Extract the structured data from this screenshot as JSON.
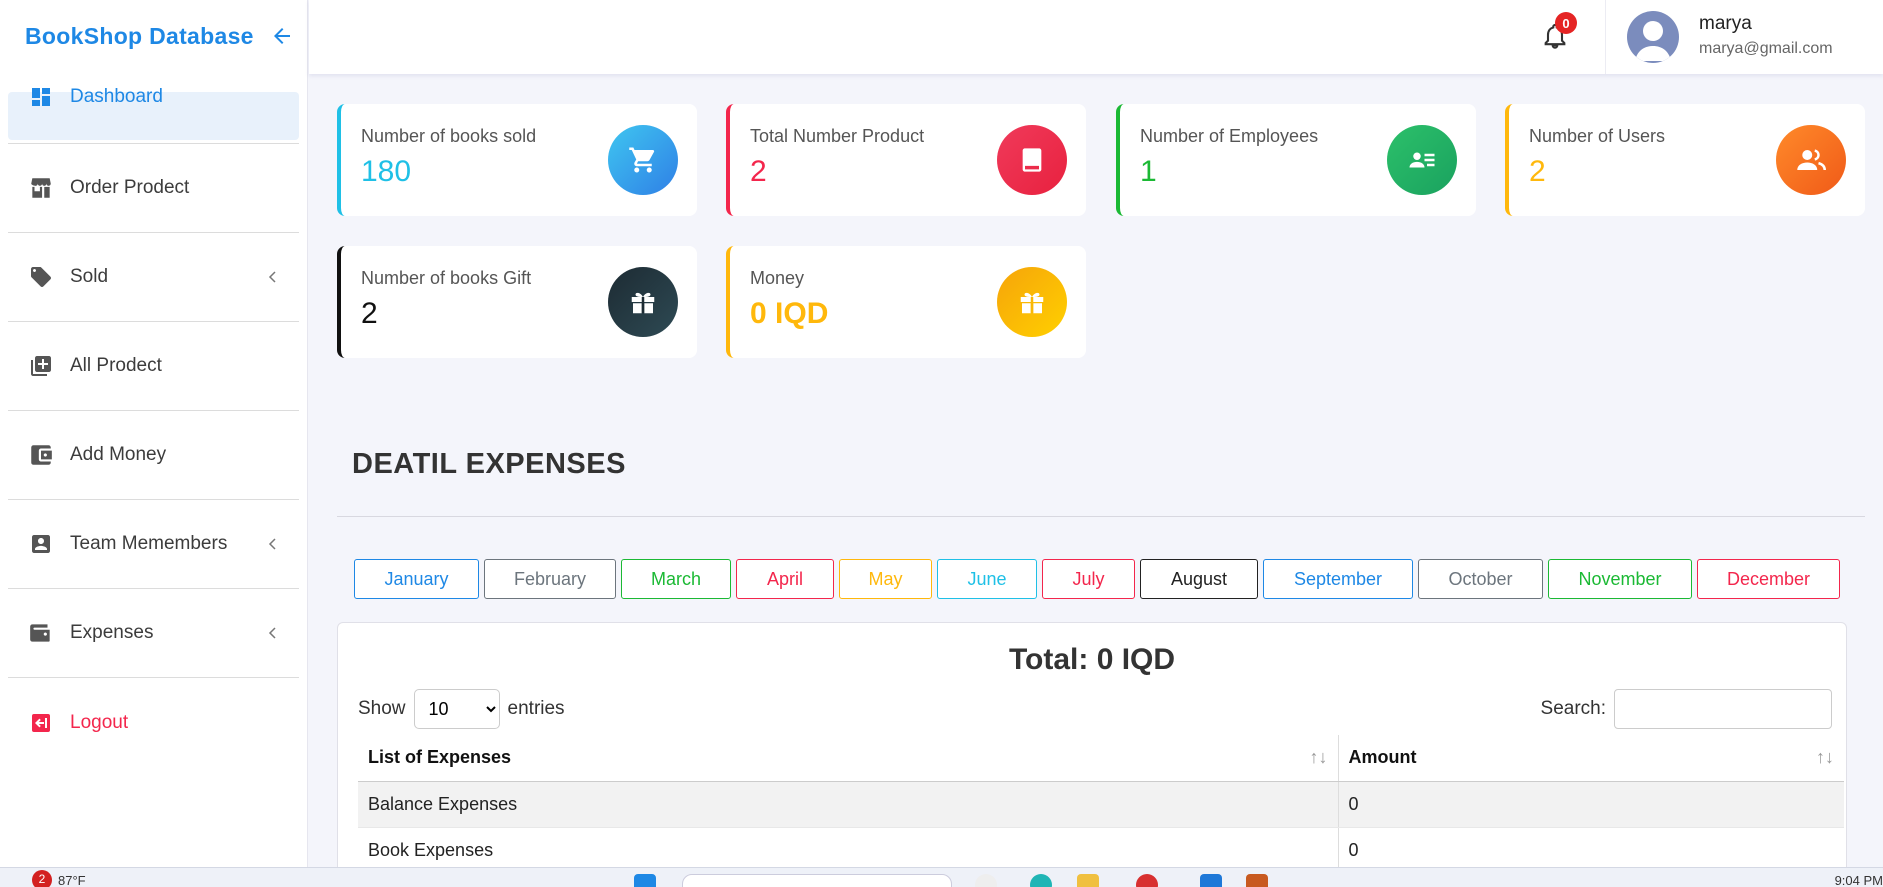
{
  "sidebar": {
    "brand": "BookShop Database",
    "items": [
      {
        "label": "Dashboard",
        "icon": "dashboard-icon"
      },
      {
        "label": "Order Prodect",
        "icon": "store-icon"
      },
      {
        "label": "Sold",
        "icon": "tag-icon"
      },
      {
        "label": "All Prodect",
        "icon": "add-box-icon"
      },
      {
        "label": "Add Money",
        "icon": "wallet-icon"
      },
      {
        "label": "Team Memembers",
        "icon": "badge-icon"
      },
      {
        "label": "Expenses",
        "icon": "wallet-icon"
      },
      {
        "label": "Logout",
        "icon": "logout-icon"
      }
    ]
  },
  "topbar": {
    "notification_count": "0",
    "user_name": "marya",
    "user_email": "marya@gmail.com"
  },
  "cards": [
    {
      "title": "Number of books sold",
      "value": "180",
      "color": "#1fc0e6",
      "icon": "cart-icon"
    },
    {
      "title": "Total Number Product",
      "value": "2",
      "color": "#f3264c",
      "icon": "book-icon"
    },
    {
      "title": "Number of Employees",
      "value": "1",
      "color": "#1bb934",
      "icon": "id-card-icon"
    },
    {
      "title": "Number of Users",
      "value": "2",
      "color": "#ffb80c",
      "icon": "users-icon"
    },
    {
      "title": "Number of books Gift",
      "value": "2",
      "color": "#111111",
      "icon": "gift-icon"
    },
    {
      "title": "Money",
      "value": "0 IQD",
      "color": "#ffb80c",
      "icon": "gift-icon"
    }
  ],
  "section": {
    "title": "DEATIL EXPENSES"
  },
  "months": [
    {
      "label": "January",
      "color": "#1e88e5"
    },
    {
      "label": "February",
      "color": "#6c757d"
    },
    {
      "label": "March",
      "color": "#1bb934"
    },
    {
      "label": "April",
      "color": "#f3264c"
    },
    {
      "label": "May",
      "color": "#ffb80c"
    },
    {
      "label": "June",
      "color": "#1fc0e6"
    },
    {
      "label": "July",
      "color": "#f3264c"
    },
    {
      "label": "August",
      "color": "#222222"
    },
    {
      "label": "September",
      "color": "#1e88e5"
    },
    {
      "label": "October",
      "color": "#6c757d"
    },
    {
      "label": "November",
      "color": "#1bb934"
    },
    {
      "label": "December",
      "color": "#f3264c"
    }
  ],
  "table": {
    "total": "Total: 0 IQD",
    "show_label": "Show",
    "entries_value": "10",
    "entries_label": "entries",
    "search_label": "Search:",
    "columns": [
      "List of Expenses",
      "Amount"
    ],
    "rows": [
      [
        "Balance Expenses",
        "0"
      ],
      [
        "Book Expenses",
        "0"
      ]
    ]
  },
  "taskbar": {
    "weather_badge": "2",
    "temperature": "87°F",
    "time": "9:04 PM"
  }
}
